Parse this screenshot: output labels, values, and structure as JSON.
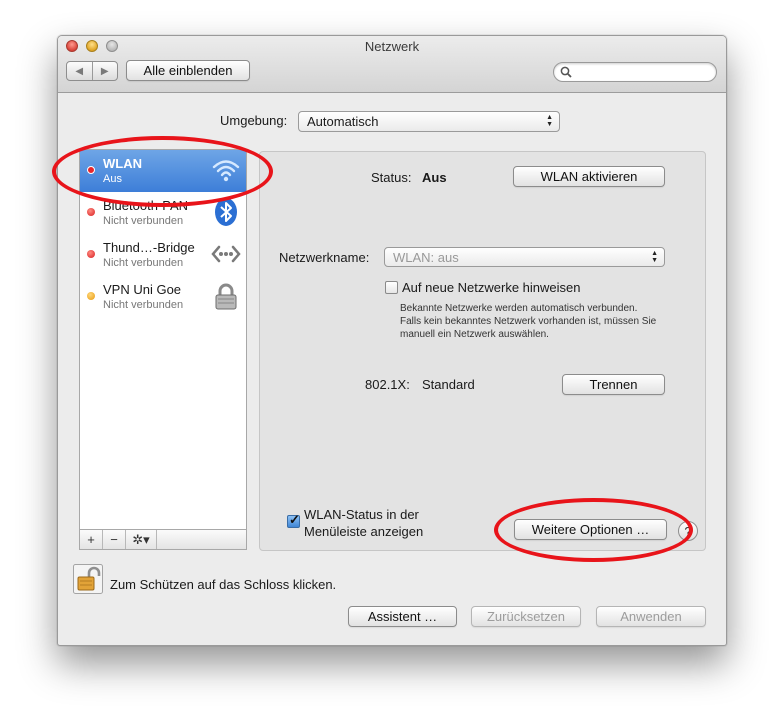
{
  "window": {
    "title": "Netzwerk"
  },
  "toolbar": {
    "back": "◀",
    "forward": "▶",
    "show_all": "Alle einblenden",
    "search_placeholder": ""
  },
  "location": {
    "label": "Umgebung:",
    "value": "Automatisch"
  },
  "services": [
    {
      "name": "WLAN",
      "status": "Aus",
      "dot_color": "#e8262b",
      "icon": "wifi-icon"
    },
    {
      "name": "Bluetooth-PAN",
      "status": "Nicht verbunden",
      "dot_color": "#e8262b",
      "icon": "bluetooth-icon"
    },
    {
      "name": "Thund…-Bridge",
      "status": "Nicht verbunden",
      "dot_color": "#e8262b",
      "icon": "thunderbolt-bridge-icon"
    },
    {
      "name": "VPN Uni Goe",
      "status": "Nicht verbunden",
      "dot_color": "#f2a81d",
      "icon": "vpn-lock-icon"
    }
  ],
  "sidebar_controls": {
    "add": "+",
    "remove": "−",
    "gear": "✲▾"
  },
  "detail": {
    "status_label": "Status:",
    "status_value": "Aus",
    "wlan_toggle": "WLAN aktivieren",
    "network_name_label": "Netzwerkname:",
    "network_name_value": "WLAN: aus",
    "ask_new_label": "Auf neue Netzwerke hinweisen",
    "ask_new_checked": false,
    "hint_1": "Bekannte Netzwerke werden automatisch verbunden.",
    "hint_2": "Falls kein bekanntes Netzwerk vorhanden ist, müssen Sie",
    "hint_3": "manuell ein Netzwerk auswählen.",
    "dot1x_label": "802.1X:",
    "dot1x_value": "Standard",
    "disconnect": "Trennen",
    "show_status_line1": "WLAN-Status in der",
    "show_status_line2": "Menüleiste anzeigen",
    "show_status_checked": true,
    "advanced": "Weitere Optionen …",
    "help": "?"
  },
  "footer": {
    "lock_text": "Zum Schützen auf das Schloss klicken.",
    "assistant": "Assistent …",
    "revert": "Zurücksetzen",
    "apply": "Anwenden"
  },
  "colors": {
    "selection": "#3d7ed8",
    "annotation": "#e8141a"
  }
}
